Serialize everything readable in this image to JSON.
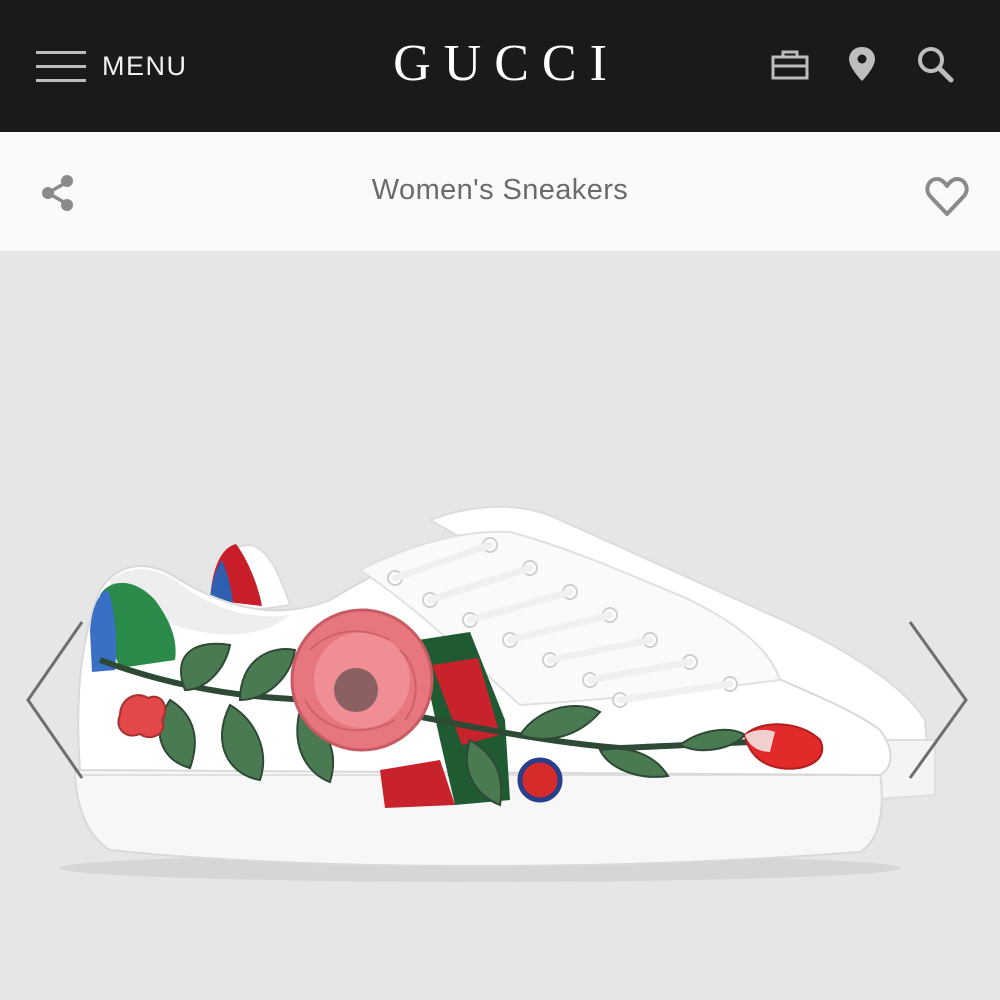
{
  "header": {
    "menu_label": "MENU",
    "brand": "GUCCI",
    "icons": [
      "shopping-bag-icon",
      "location-pin-icon",
      "search-icon"
    ]
  },
  "subheader": {
    "title": "Women's Sneakers",
    "icons": [
      "share-icon",
      "heart-icon"
    ]
  },
  "product_image": {
    "alt": "Ace embroidered sneaker",
    "navigation": [
      "previous-arrow",
      "next-arrow"
    ]
  },
  "colors": {
    "header_bg": "#1a1a1a",
    "subheader_bg": "#fafafa",
    "stage_bg": "#e6e6e6",
    "title_text": "#6b6b6b",
    "icon_gray": "#8a8a8a",
    "web_stripe_green": "#1f5a32",
    "web_stripe_red": "#c8232c"
  }
}
